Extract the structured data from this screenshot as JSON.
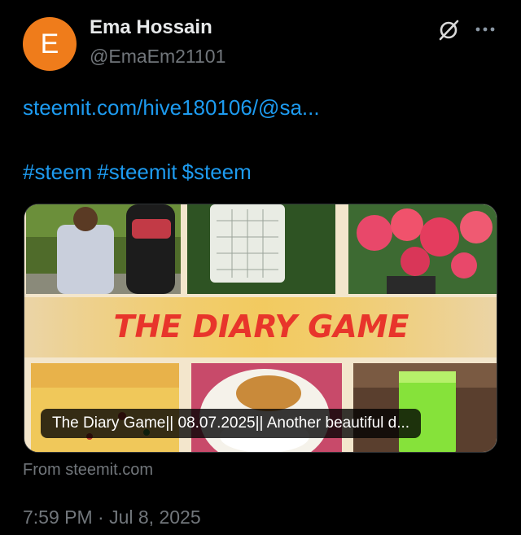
{
  "author": {
    "initial": "E",
    "name": "Ema Hossain",
    "handle": "@EmaEm21101",
    "avatar_color": "#ef7c1b"
  },
  "icons": {
    "grok": "grok-icon",
    "more": "more-icon"
  },
  "post": {
    "link": "steemit.com/hive180106/@sa...",
    "hashtags": [
      "#steem",
      "#steemit",
      "$steem"
    ]
  },
  "card": {
    "banner_title": "THE DIARY GAME",
    "caption": "The Diary Game|| 08.07.2025|| Another beautiful d...",
    "source": "From steemit.com"
  },
  "meta": {
    "timestamp": "7:59 PM · Jul 8, 2025"
  },
  "colors": {
    "background": "#000000",
    "link": "#1d9bf0",
    "muted": "#71767b",
    "banner_text": "#e8352b"
  }
}
